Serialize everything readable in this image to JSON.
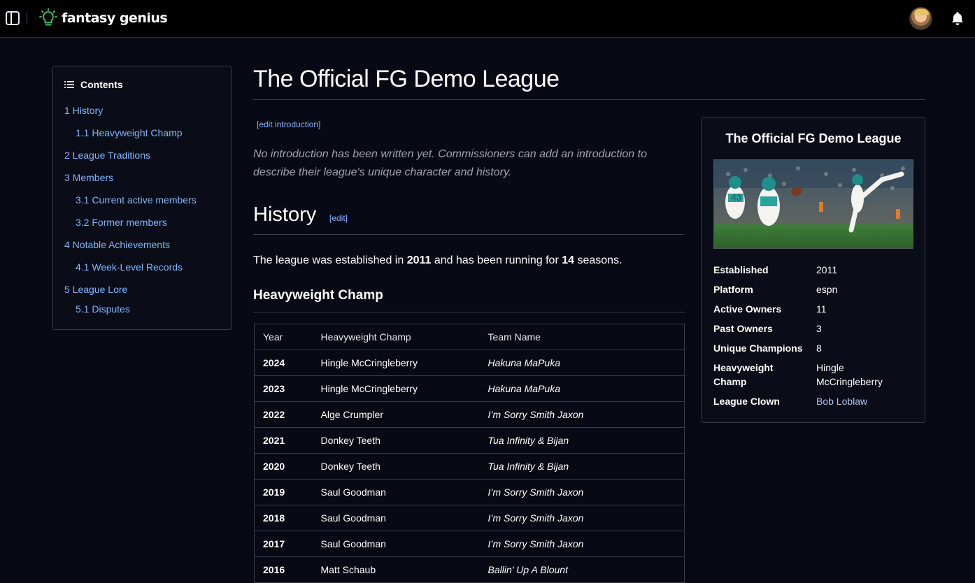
{
  "header": {
    "logo_text": "fantasy genius",
    "icons": {
      "sidebar_toggle": "sidebar-toggle-icon",
      "logo": "lightbulb-icon",
      "notifications": "bell-icon"
    }
  },
  "toc": {
    "title": "Contents",
    "items": [
      {
        "label": "1 History",
        "level": 1
      },
      {
        "label": "1.1 Heavyweight Champ",
        "level": 2
      },
      {
        "label": "2 League Traditions",
        "level": 1
      },
      {
        "label": "3 Members",
        "level": 1
      },
      {
        "label": "3.1 Current active members",
        "level": 2
      },
      {
        "label": "3.2 Former members",
        "level": 2
      },
      {
        "label": "4 Notable Achievements",
        "level": 1
      },
      {
        "label": "4.1 Week-Level Records",
        "level": 2
      },
      {
        "label": "5 League Lore",
        "level": 1
      },
      {
        "label": "5.1 Disputes",
        "level": 2
      }
    ]
  },
  "main": {
    "title": "The Official FG Demo League",
    "edit_intro_label": "[edit introduction]",
    "intro": "No introduction has been written yet. Commissioners can add an introduction to describe their league's unique character and history.",
    "history": {
      "heading": "History",
      "edit_label": "[edit]",
      "text_before": "The league was established in ",
      "established": "2011",
      "text_middle": " and has been running for ",
      "seasons": "14",
      "text_after": " seasons."
    },
    "champ_section": {
      "heading": "Heavyweight Champ",
      "columns": [
        "Year",
        "Heavyweight Champ",
        "Team Name"
      ],
      "rows": [
        [
          "2024",
          "Hingle McCringleberry",
          "Hakuna MaPuka"
        ],
        [
          "2023",
          "Hingle McCringleberry",
          "Hakuna MaPuka"
        ],
        [
          "2022",
          "Alge Crumpler",
          "I’m Sorry Smith Jaxon"
        ],
        [
          "2021",
          "Donkey Teeth",
          "Tua Infinity & Bijan"
        ],
        [
          "2020",
          "Donkey Teeth",
          "Tua Infinity & Bijan"
        ],
        [
          "2019",
          "Saul Goodman",
          "I’m Sorry Smith Jaxon"
        ],
        [
          "2018",
          "Saul Goodman",
          "I’m Sorry Smith Jaxon"
        ],
        [
          "2017",
          "Saul Goodman",
          "I’m Sorry Smith Jaxon"
        ],
        [
          "2016",
          "Matt Schaub",
          "Ballin' Up A Blount"
        ]
      ]
    }
  },
  "infobox": {
    "title": "The Official FG Demo League",
    "image_alt": "punter-kicking-football-photo",
    "rows": [
      {
        "label": "Established",
        "value": "2011"
      },
      {
        "label": "Platform",
        "value": "espn"
      },
      {
        "label": "Active Owners",
        "value": "11"
      },
      {
        "label": "Past Owners",
        "value": "3"
      },
      {
        "label": "Unique Champions",
        "value": "8"
      },
      {
        "label": "Heavyweight Champ",
        "value": "Hingle McCringleberry"
      },
      {
        "label": "League Clown",
        "value": "Bob Loblaw"
      }
    ]
  },
  "colors": {
    "background": "#070a14",
    "link": "#7fb4ff",
    "accent_green": "#3fd16a"
  }
}
